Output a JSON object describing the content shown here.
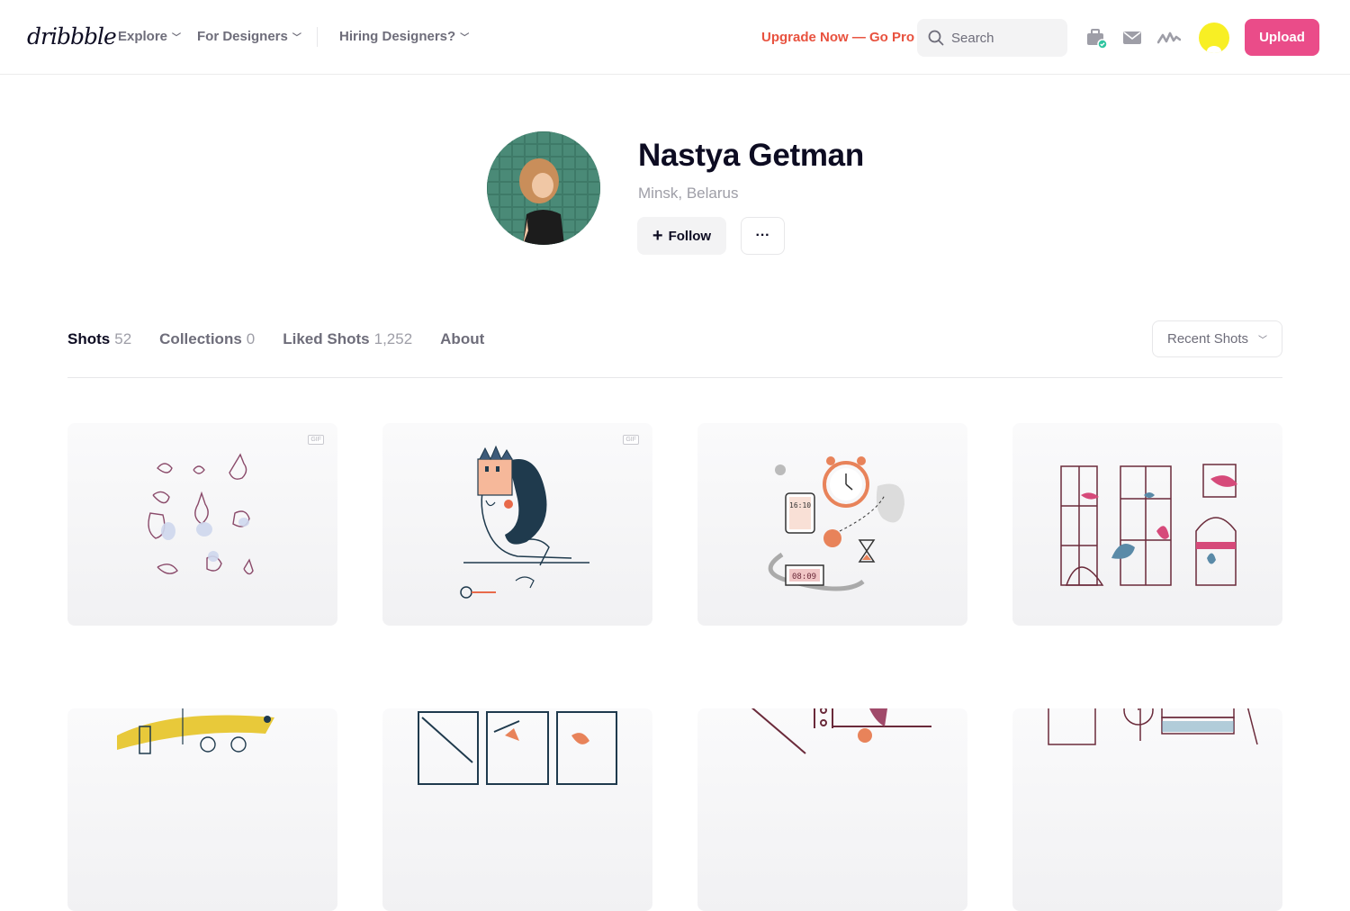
{
  "header": {
    "logo": "dribbble",
    "nav": [
      {
        "label": "Explore"
      },
      {
        "label": "For Designers"
      },
      {
        "label": "Hiring Designers?"
      }
    ],
    "upgrade": "Upgrade Now — Go Pro",
    "search_placeholder": "Search",
    "upload_label": "Upload",
    "icons": [
      "briefcase-icon",
      "mail-icon",
      "activity-icon"
    ]
  },
  "profile": {
    "name": "Nastya Getman",
    "location": "Minsk, Belarus",
    "follow_label": "Follow",
    "more_label": "···"
  },
  "tabs": [
    {
      "label": "Shots",
      "count": "52"
    },
    {
      "label": "Collections",
      "count": "0"
    },
    {
      "label": "Liked Shots",
      "count": "1,252"
    },
    {
      "label": "About",
      "count": ""
    }
  ],
  "sort": {
    "selected": "Recent Shots"
  },
  "shots": [
    {
      "badge": "GIF"
    },
    {
      "badge": "GIF"
    },
    {
      "badge": "",
      "clock_display": "16:10",
      "alarm_display": "08:09"
    },
    {
      "badge": ""
    }
  ],
  "colors": {
    "brand_pink": "#ea4c89",
    "upgrade_red": "#e8523f",
    "text_dark": "#0d0c22",
    "text_muted": "#6e6d7a"
  }
}
